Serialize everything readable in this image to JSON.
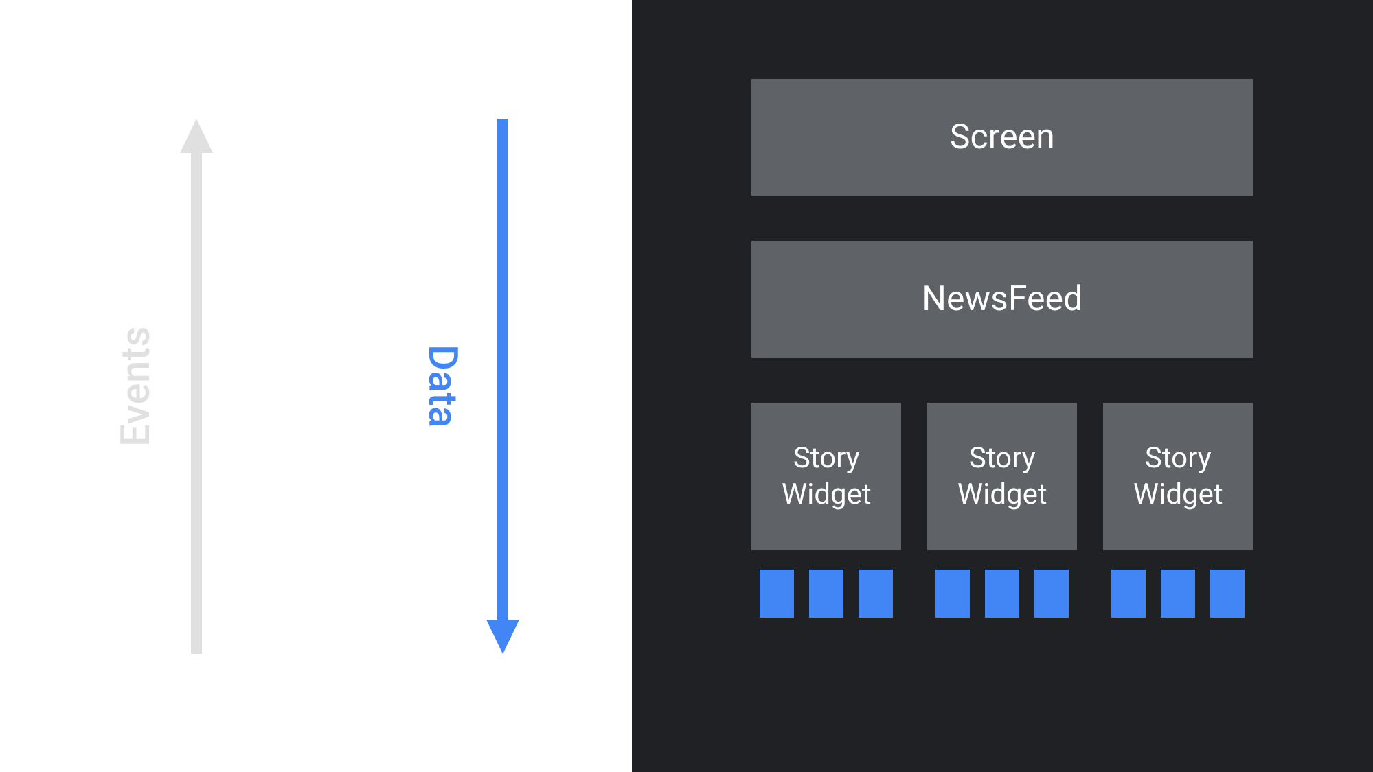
{
  "left": {
    "events_label": "Events",
    "data_label": "Data",
    "colors": {
      "events_arrow": "#e0e0e0",
      "data_arrow": "#4285F4"
    }
  },
  "right": {
    "screen_label": "Screen",
    "newsfeed_label": "NewsFeed",
    "widgets": [
      {
        "label": "Story\nWidget",
        "chips": 3
      },
      {
        "label": "Story\nWidget",
        "chips": 3
      },
      {
        "label": "Story\nWidget",
        "chips": 3
      }
    ],
    "colors": {
      "background": "#202124",
      "box": "#5f6368",
      "chip": "#4285F4",
      "text": "#ffffff"
    }
  }
}
